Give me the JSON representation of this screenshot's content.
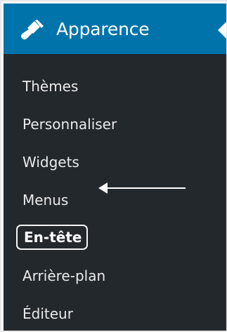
{
  "menu": {
    "title": "Apparence",
    "icon": "paintbrush-icon"
  },
  "submenu": {
    "items": [
      "Thèmes",
      "Personnaliser",
      "Widgets",
      "Menus",
      "En-tête",
      "Arrière-plan",
      "Éditeur"
    ],
    "current": "En-tête"
  },
  "annotation": {
    "type": "arrow",
    "color": "#ffffff",
    "points_to": "En-tête"
  },
  "colors": {
    "menu_background": "#23282d",
    "active_header": "#0073aa",
    "text": "#eaeaea",
    "highlight_border": "#f5f5f5"
  }
}
